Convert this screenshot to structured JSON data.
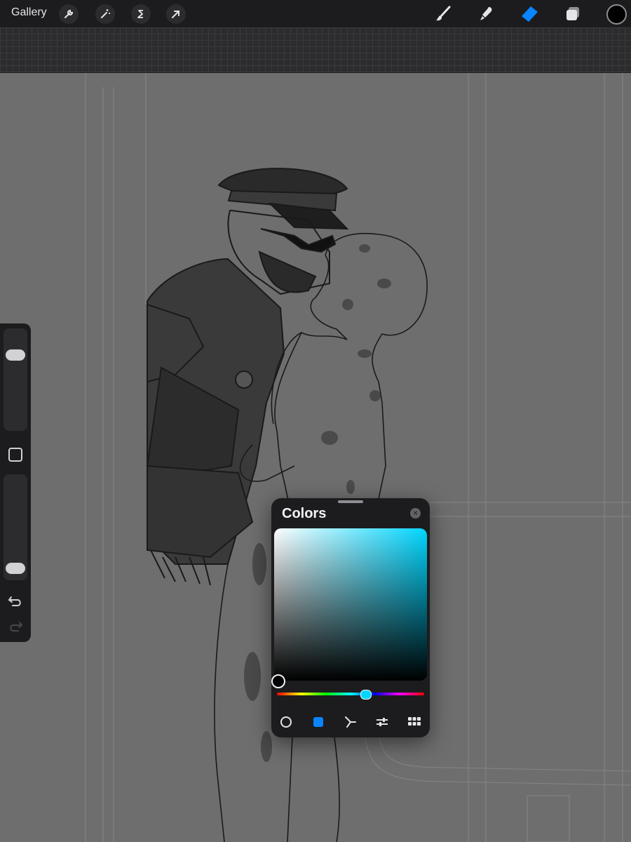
{
  "toolbar": {
    "gallery_label": "Gallery",
    "left_tools": [
      "wrench-icon",
      "magic-wand-icon",
      "selection-s-icon",
      "transform-arrow-icon"
    ],
    "right_tools": [
      "brush-icon",
      "smudge-icon",
      "eraser-icon",
      "layers-icon"
    ],
    "active_tool": "eraser",
    "active_color": "#000000",
    "accent": "#0a84ff"
  },
  "sidebar": {
    "brush_size_level": 0.78,
    "opacity_level": 0.05,
    "icons": [
      "square-modify-icon",
      "undo-icon",
      "redo-icon"
    ]
  },
  "colors_panel": {
    "title": "Colors",
    "hue_color": "#00d6ff",
    "selected_color": "#000000",
    "hue_position": 0.6,
    "tabs": [
      "disc-icon",
      "classic-square-icon",
      "harmony-icon",
      "value-sliders-icon",
      "palettes-grid-icon"
    ],
    "active_tab": "classic-square-icon"
  }
}
